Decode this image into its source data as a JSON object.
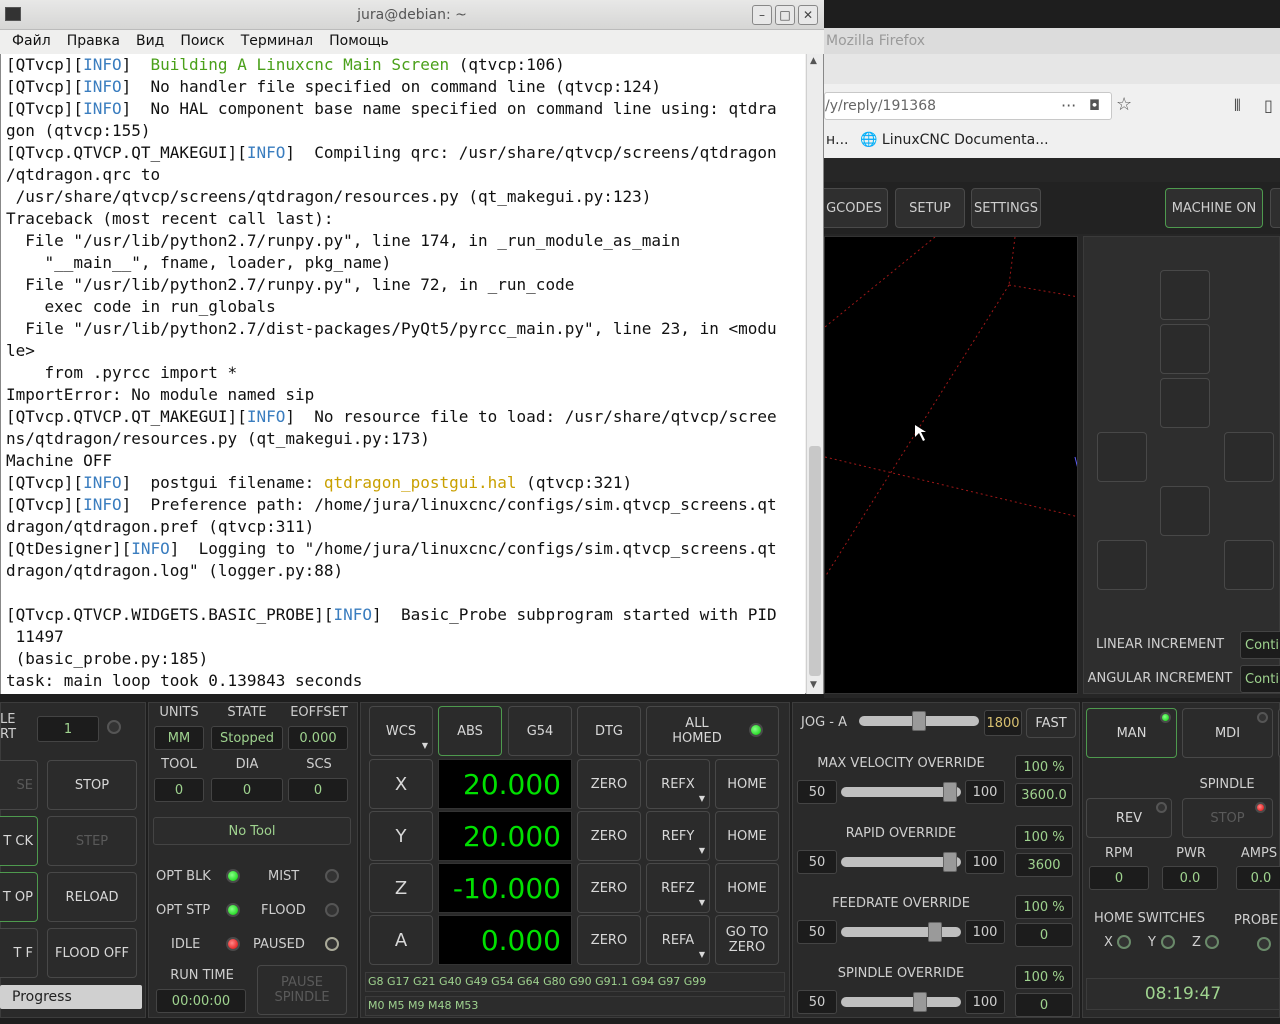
{
  "terminal": {
    "title": "jura@debian: ~",
    "menu": [
      "Файл",
      "Правка",
      "Вид",
      "Поиск",
      "Терминал",
      "Помощь"
    ],
    "lines": [
      [
        {
          "t": "[QTvcp]["
        },
        {
          "t": "INFO",
          "c": "info"
        },
        {
          "t": "]  "
        },
        {
          "t": "Building A Linuxcnc Main Screen",
          "c": "green"
        },
        {
          "t": " (qtvcp:106)"
        }
      ],
      [
        {
          "t": "[QTvcp]["
        },
        {
          "t": "INFO",
          "c": "info"
        },
        {
          "t": "]  No handler file specified on command line (qtvcp:124)"
        }
      ],
      [
        {
          "t": "[QTvcp]["
        },
        {
          "t": "INFO",
          "c": "info"
        },
        {
          "t": "]  No HAL component base name specified on command line using: qtdra"
        }
      ],
      [
        {
          "t": "gon (qtvcp:155)"
        }
      ],
      [
        {
          "t": "[QTvcp.QTVCP.QT_MAKEGUI]["
        },
        {
          "t": "INFO",
          "c": "info"
        },
        {
          "t": "]  Compiling qrc: /usr/share/qtvcp/screens/qtdragon"
        }
      ],
      [
        {
          "t": "/qtdragon.qrc to"
        }
      ],
      [
        {
          "t": " /usr/share/qtvcp/screens/qtdragon/resources.py (qt_makegui.py:123)"
        }
      ],
      [
        {
          "t": "Traceback (most recent call last):"
        }
      ],
      [
        {
          "t": "  File \"/usr/lib/python2.7/runpy.py\", line 174, in _run_module_as_main"
        }
      ],
      [
        {
          "t": "    \"__main__\", fname, loader, pkg_name)"
        }
      ],
      [
        {
          "t": "  File \"/usr/lib/python2.7/runpy.py\", line 72, in _run_code"
        }
      ],
      [
        {
          "t": "    exec code in run_globals"
        }
      ],
      [
        {
          "t": "  File \"/usr/lib/python2.7/dist-packages/PyQt5/pyrcc_main.py\", line 23, in <modu"
        }
      ],
      [
        {
          "t": "le>"
        }
      ],
      [
        {
          "t": "    from .pyrcc import *"
        }
      ],
      [
        {
          "t": "ImportError: No module named sip"
        }
      ],
      [
        {
          "t": "[QTvcp.QTVCP.QT_MAKEGUI]["
        },
        {
          "t": "INFO",
          "c": "info"
        },
        {
          "t": "]  No resource file to load: /usr/share/qtvcp/scree"
        }
      ],
      [
        {
          "t": "ns/qtdragon/resources.py (qt_makegui.py:173)"
        }
      ],
      [
        {
          "t": "Machine OFF"
        }
      ],
      [
        {
          "t": "[QTvcp]["
        },
        {
          "t": "INFO",
          "c": "info"
        },
        {
          "t": "]  postgui filename: "
        },
        {
          "t": "qtdragon_postgui.hal",
          "c": "orange"
        },
        {
          "t": " (qtvcp:321)"
        }
      ],
      [
        {
          "t": "[QTvcp]["
        },
        {
          "t": "INFO",
          "c": "info"
        },
        {
          "t": "]  Preference path: /home/jura/linuxcnc/configs/sim.qtvcp_screens.qt"
        }
      ],
      [
        {
          "t": "dragon/qtdragon.pref (qtvcp:311)"
        }
      ],
      [
        {
          "t": "[QtDesigner]["
        },
        {
          "t": "INFO",
          "c": "info"
        },
        {
          "t": "]  Logging to \"/home/jura/linuxcnc/configs/sim.qtvcp_screens.qt"
        }
      ],
      [
        {
          "t": "dragon/qtdragon.log\" (logger.py:88)"
        }
      ],
      [
        {
          "t": ""
        }
      ],
      [
        {
          "t": "[QTvcp.QTVCP.WIDGETS.BASIC_PROBE]["
        },
        {
          "t": "INFO",
          "c": "info"
        },
        {
          "t": "]  Basic_Probe subprogram started with PID"
        }
      ],
      [
        {
          "t": " 11497"
        }
      ],
      [
        {
          "t": " (basic_probe.py:185)"
        }
      ],
      [
        {
          "t": "task: main loop took 0.139843 seconds"
        }
      ]
    ]
  },
  "firefox": {
    "title": "Mozilla Firefox",
    "url": "/y/reply/191368",
    "url_dots": "···",
    "bookmark_prefix": "н...",
    "bookmark": "LinuxCNC Documenta..."
  },
  "qtdragon": {
    "tabs": [
      "GCODES",
      "SETUP",
      "SETTINGS"
    ],
    "machine_on": "MACHINE ON",
    "linear_increment_label": "LINEAR INCREMENT",
    "angular_increment_label": "ANGULAR INCREMENT",
    "increment_value": "Conti",
    "left": {
      "top_label": "LE RT",
      "top_value": "1",
      "stop": "STOP",
      "step": "STEP",
      "reload": "RELOAD",
      "flood_off": "FLOOD OFF",
      "left_btns": [
        "SE",
        "T CK",
        "T OP",
        "T F"
      ],
      "progress": "Progress"
    },
    "status": {
      "units_label": "UNITS",
      "units": "MM",
      "state_label": "STATE",
      "state": "Stopped",
      "eoffset_label": "EOFFSET",
      "eoffset": "0.000",
      "tool_label": "TOOL",
      "tool": "0",
      "dia_label": "DIA",
      "dia": "0",
      "scs_label": "SCS",
      "scs": "0",
      "no_tool": "No Tool",
      "opt_blk": "OPT BLK",
      "mist": "MIST",
      "opt_stp": "OPT STP",
      "flood": "FLOOD",
      "idle": "IDLE",
      "paused": "PAUSED",
      "run_time_label": "RUN TIME",
      "run_time": "00:00:00",
      "pause_spindle": "PAUSE SPINDLE"
    },
    "dro": {
      "wcs": "WCS",
      "abs": "ABS",
      "g54": "G54",
      "dtg": "DTG",
      "all_homed": "ALL HOMED",
      "axes": [
        {
          "name": "X",
          "value": "20.000",
          "zero": "ZERO",
          "ref": "REFX",
          "home": "HOME"
        },
        {
          "name": "Y",
          "value": "20.000",
          "zero": "ZERO",
          "ref": "REFY",
          "home": "HOME"
        },
        {
          "name": "Z",
          "value": "-10.000",
          "zero": "ZERO",
          "ref": "REFZ",
          "home": "HOME"
        },
        {
          "name": "A",
          "value": "0.000",
          "zero": "ZERO",
          "ref": "REFA",
          "home": "GO TO ZERO"
        }
      ],
      "gcodes": "G8 G17 G21 G40 G49 G54 G64 G80 G90 G91.1 G94 G97 G99",
      "mcodes": "M0 M5 M9 M48 M53"
    },
    "overrides": {
      "jog_label": "JOG - A",
      "jog_value": "1800",
      "fast": "FAST",
      "items": [
        {
          "label": "MAX VELOCITY OVERRIDE",
          "min": "50",
          "max": "100",
          "pct": "100 %",
          "value": "3600.0",
          "level": 0.96
        },
        {
          "label": "RAPID OVERRIDE",
          "min": "50",
          "max": "100",
          "pct": "100 %",
          "value": "3600",
          "level": 0.96
        },
        {
          "label": "FEEDRATE OVERRIDE",
          "min": "50",
          "max": "100",
          "pct": "100 %",
          "value": "0",
          "level": 0.82
        },
        {
          "label": "SPINDLE OVERRIDE",
          "min": "50",
          "max": "100",
          "pct": "100 %",
          "value": "0",
          "level": 0.68
        }
      ]
    },
    "right": {
      "man": "MAN",
      "mdi": "MDI",
      "spindle": "SPINDLE",
      "rev": "REV",
      "stop": "STOP",
      "rpm_label": "RPM",
      "rpm": "0",
      "pwr_label": "PWR",
      "pwr": "0.0",
      "amps_label": "AMPS",
      "amps": "0.0",
      "home_switches": "HOME SWITCHES",
      "probe": "PROBE",
      "x": "X",
      "y": "Y",
      "z": "Z",
      "clock": "08:19:47"
    }
  },
  "colors": {
    "dro_green": "#00e000",
    "info_blue": "#3a7dbf",
    "terminal_bg": "#ffffff"
  }
}
